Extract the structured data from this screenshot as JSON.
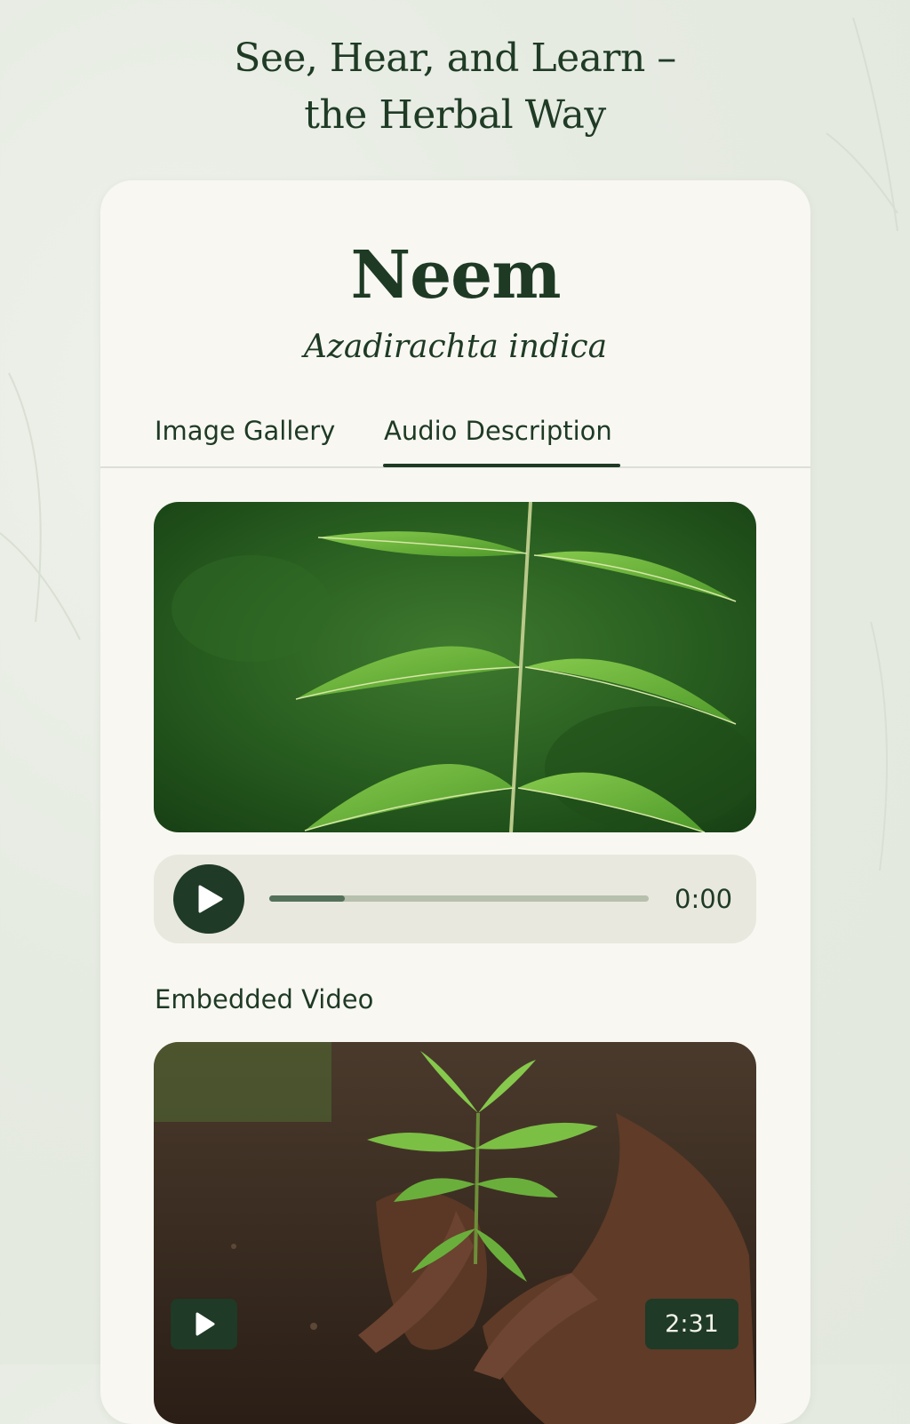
{
  "headline": {
    "line1": "See, Hear, and Learn –",
    "line2": "the Herbal Way"
  },
  "plant": {
    "name": "Neem",
    "scientific_name": "Azadirachta indica"
  },
  "tabs": [
    {
      "label": "Image Gallery",
      "active": false
    },
    {
      "label": "Audio Description",
      "active": true
    }
  ],
  "hero_image": {
    "icon": "neem-leaf-photo"
  },
  "audio": {
    "time": "0:00",
    "progress": 0.2,
    "play_icon": "play-icon"
  },
  "video_section": {
    "label": "Embedded Video",
    "duration": "2:31",
    "play_icon": "play-icon"
  },
  "colors": {
    "background": "#e6ebe2",
    "card": "#f8f7f2",
    "primary": "#1e3a24",
    "player_bg": "#e8e8de",
    "progress_track": "#b7bfad",
    "progress_fill": "#54705a"
  }
}
